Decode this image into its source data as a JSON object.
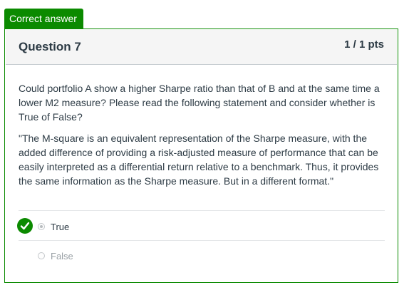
{
  "badge": {
    "text": "Correct answer"
  },
  "question": {
    "title": "Question 7",
    "points": "1 / 1 pts",
    "paragraphs": [
      "Could portfolio A show a higher Sharpe ratio than that of B and at the same time a lower M2 measure? Please read the following statement and consider whether is True of False?",
      "\"The M-square is an equivalent representation of the Sharpe measure, with the added difference of providing a risk-adjusted measure of performance that can be easily interpreted as a differential return relative to a benchmark. Thus, it provides the same information as the Sharpe measure. But in a different format.\""
    ]
  },
  "answers": [
    {
      "label": "True",
      "selected": true,
      "correct": true
    },
    {
      "label": "False",
      "selected": false,
      "correct": false
    }
  ],
  "colors": {
    "correct": "#0b8a00",
    "text": "#2d3b45",
    "muted": "#9aa1a6",
    "header_bg": "#f5f5f5"
  },
  "icons": {
    "correct_marker": "checkmark-icon"
  }
}
